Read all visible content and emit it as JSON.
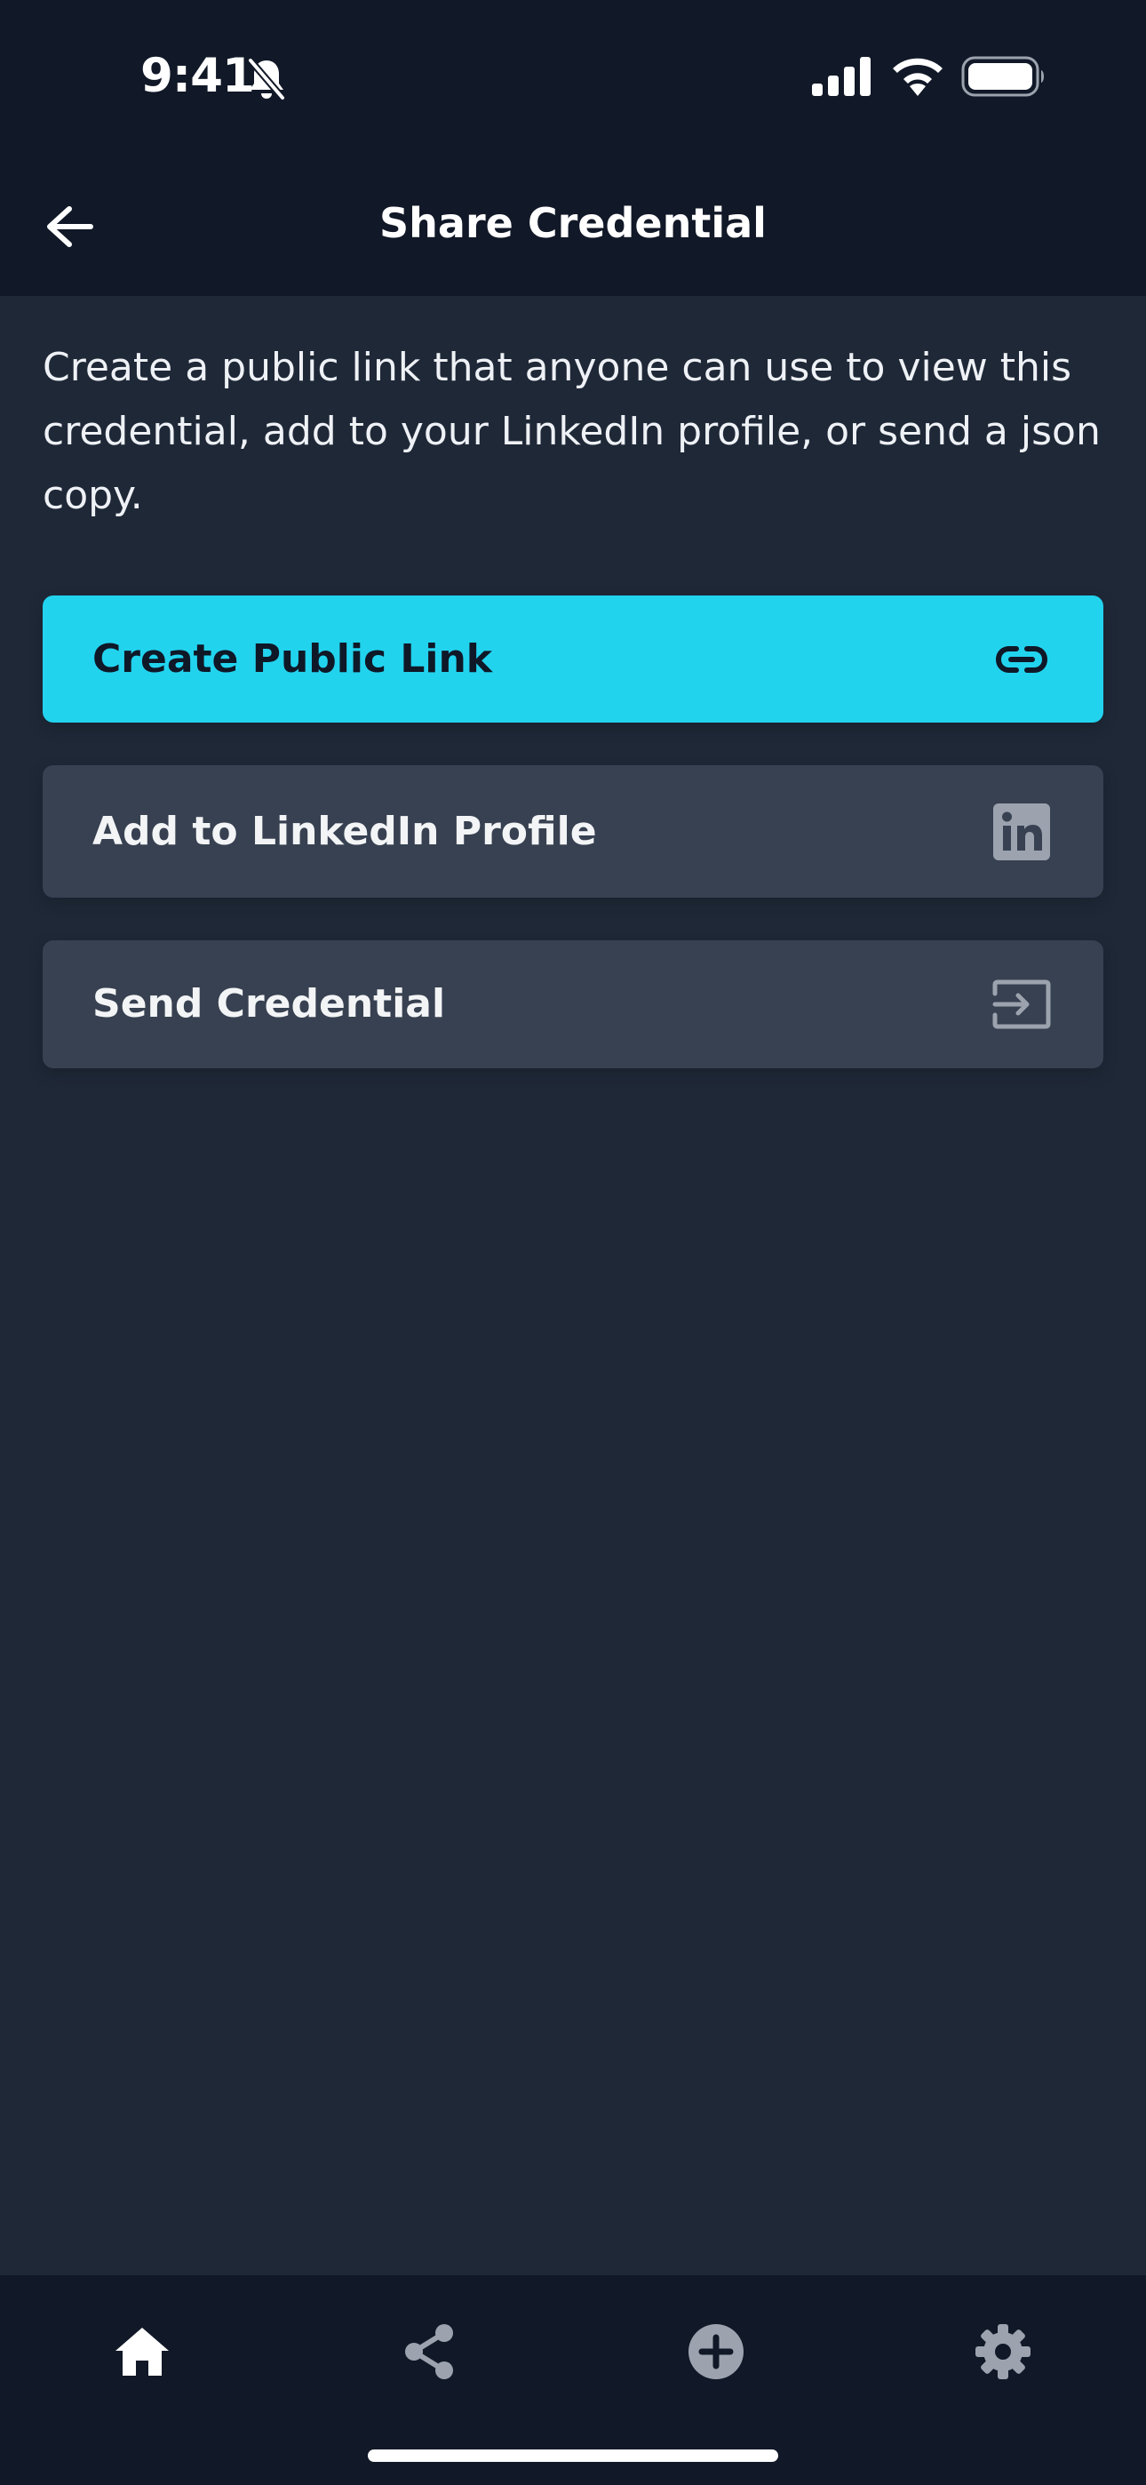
{
  "status_bar": {
    "time": "9:41"
  },
  "header": {
    "title": "Share Credential",
    "back_icon": "arrow-left-icon"
  },
  "main": {
    "description": "Create a public link that anyone can use to view this credential, add to your LinkedIn profile, or send a json copy.",
    "actions": [
      {
        "label": "Create Public Link",
        "icon": "link-icon"
      },
      {
        "label": "Add to LinkedIn Profile",
        "icon": "linkedin-icon"
      },
      {
        "label": "Send Credential",
        "icon": "send-icon"
      }
    ]
  },
  "tab_bar": {
    "tabs": [
      {
        "icon": "home-icon",
        "active": true
      },
      {
        "icon": "share-icon",
        "active": false
      },
      {
        "icon": "add-circle-icon",
        "active": false
      },
      {
        "icon": "gear-icon",
        "active": false
      }
    ]
  },
  "colors": {
    "background": "#1f2837",
    "header_background": "#111827",
    "accent": "#22d3ee",
    "secondary_button": "#374151",
    "icon_muted": "#9ca3af"
  }
}
